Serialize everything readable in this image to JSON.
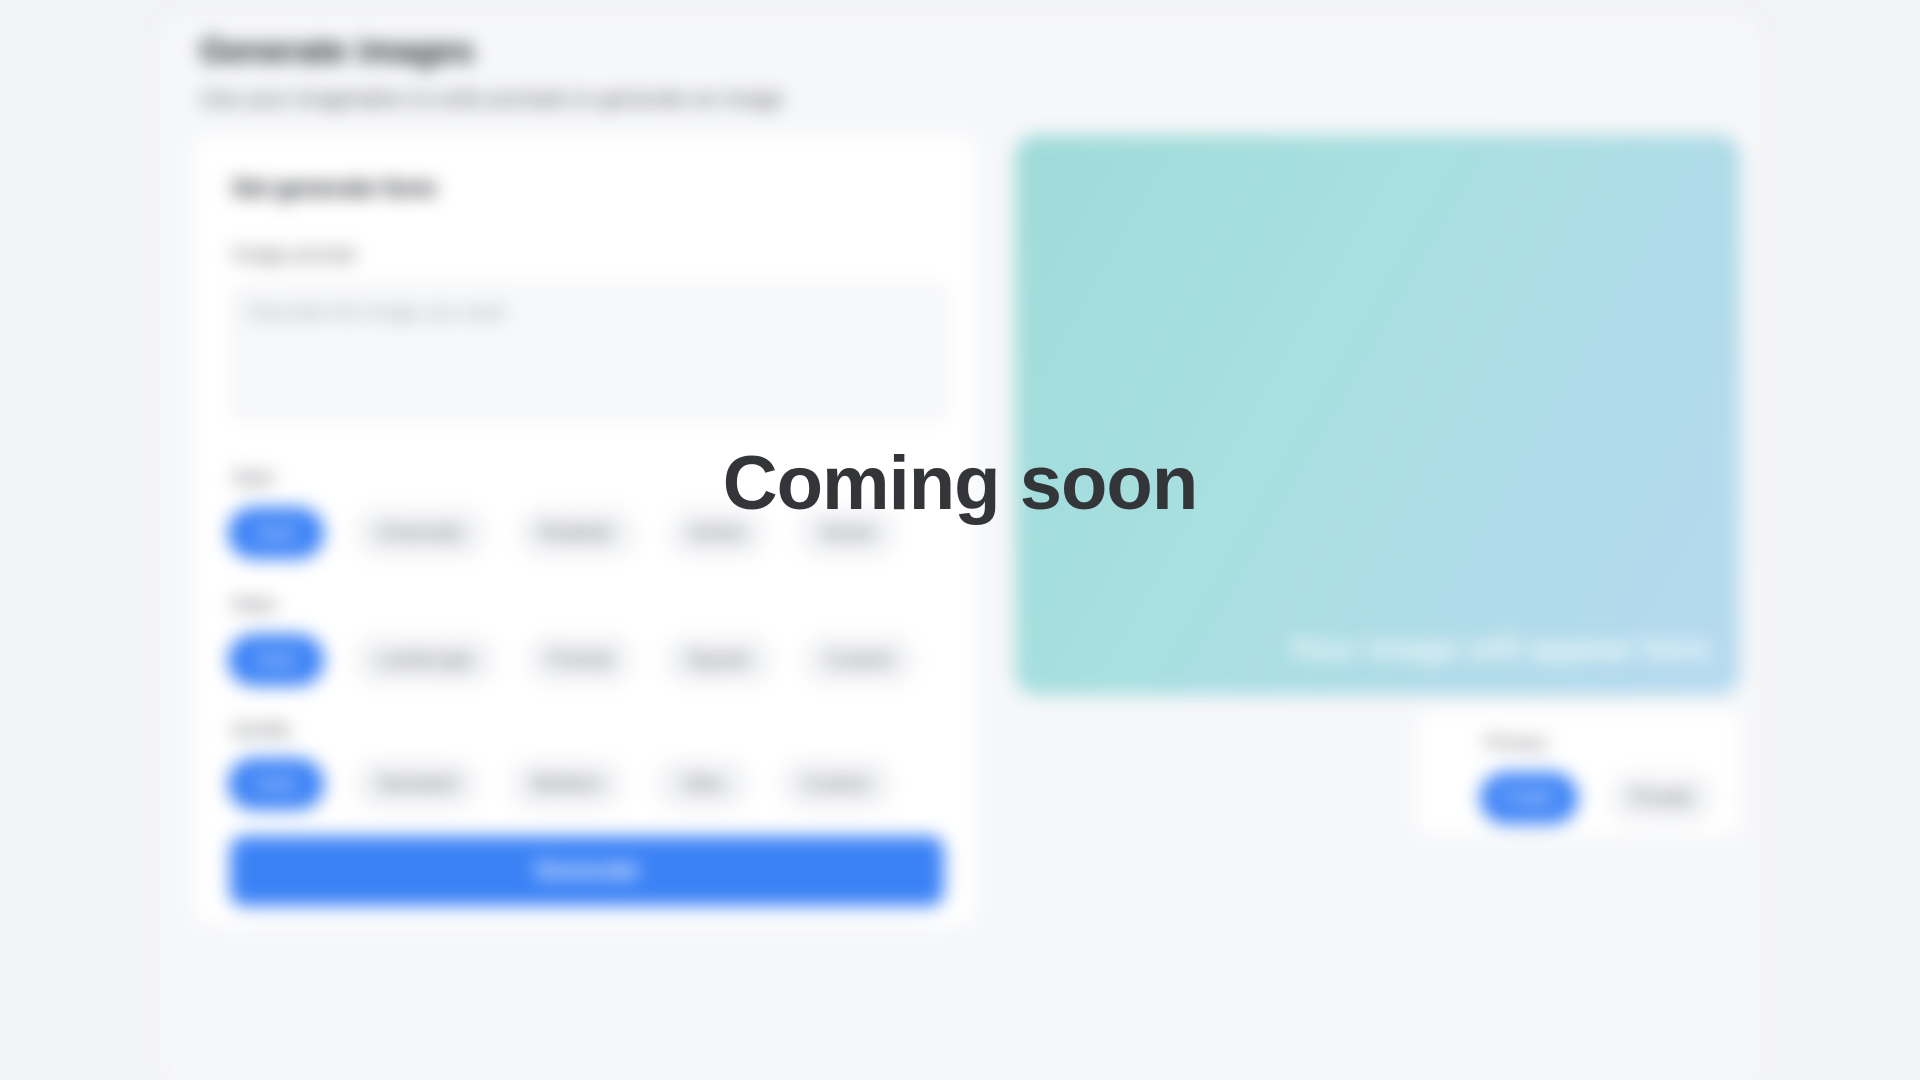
{
  "overlay": {
    "message": "Coming soon"
  },
  "page": {
    "title": "Generate images",
    "subtitle": "Use your imagination to write prompts to generate an image"
  },
  "form": {
    "heading": "Set generate form",
    "prompt_label": "Image prompt",
    "prompt_placeholder": "Describe the image you want",
    "option_groups": [
      {
        "label": "Style",
        "options": [
          "Auto",
          "Cinematic",
          "Realistic",
          "Anime",
          "Vector"
        ],
        "selected": "Auto"
      },
      {
        "label": "Ratio",
        "options": [
          "Auto",
          "Landscape",
          "Portrait",
          "Square",
          "Custom"
        ],
        "selected": "Auto"
      },
      {
        "label": "Quality",
        "options": [
          "Auto",
          "Standard",
          "Medium",
          "Ultra",
          "Custom"
        ],
        "selected": "Auto"
      }
    ],
    "generate_label": "Generate"
  },
  "preview": {
    "caption": "Your image will appear here",
    "gradient_colors": [
      "#9fdbd9",
      "#b6daf0"
    ]
  },
  "mini_panel": {
    "label": "Privacy",
    "options": [
      "Public",
      "Private"
    ],
    "selected": "Public"
  },
  "colors": {
    "accent": "#3b82f6",
    "background": "#f2f3f5",
    "overlay_text": "#333538"
  }
}
